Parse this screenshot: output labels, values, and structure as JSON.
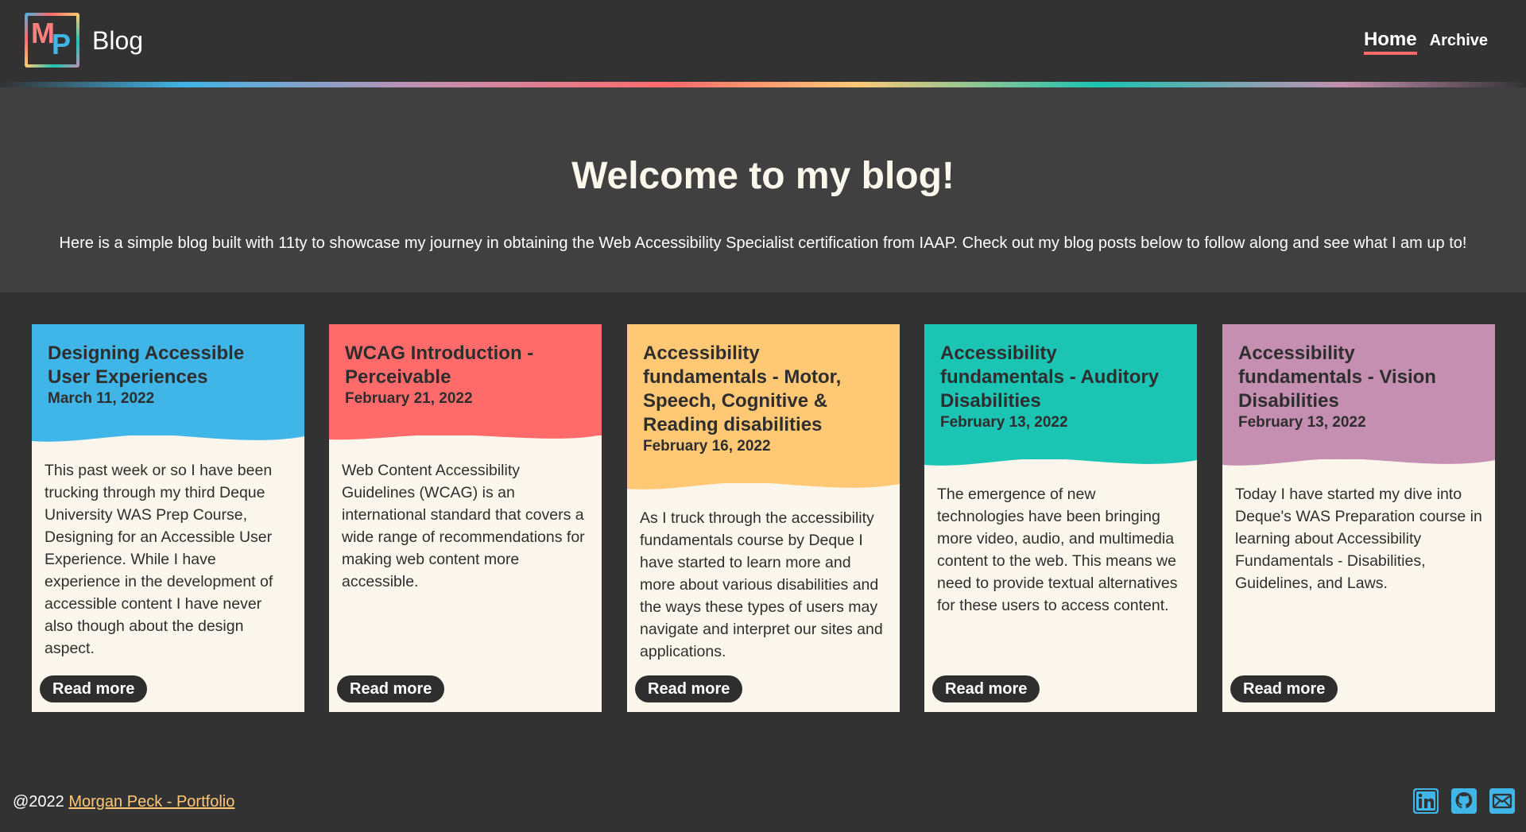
{
  "header": {
    "logo_letters": "MP",
    "site_title": "Blog",
    "nav": [
      {
        "label": "Home"
      },
      {
        "label": "Archive"
      }
    ]
  },
  "hero": {
    "title": "Welcome to my blog!",
    "intro": "Here is a simple blog built with 11ty to showcase my journey in obtaining the Web Accessibility Specialist certification from IAAP. Check out my blog posts below to follow along and see what I am up to!"
  },
  "posts": [
    {
      "title": "Designing Accessible User Experiences",
      "date": "March 11, 2022",
      "excerpt": "This past week or so I have been trucking through my third Deque University WAS Prep Course, Designing for an Accessible User Experience. While I have experience in the development of accessible content I have never also though about the design aspect.",
      "color": "#3fb5e8",
      "button": "Read more"
    },
    {
      "title": "WCAG Introduction - Perceivable",
      "date": "February 21, 2022",
      "excerpt": "Web Content Accessibility Guidelines (WCAG) is an international standard that covers a wide range of recommendations for making web content more accessible.",
      "color": "#ff6b6b",
      "button": "Read more"
    },
    {
      "title": "Accessibility fundamentals - Motor, Speech, Cognitive & Reading disabilities",
      "date": "February 16, 2022",
      "excerpt": "As I truck through the accessibility fundamentals course by Deque I have started to learn more and more about various disabilities and the ways these types of users may navigate and interpret our sites and applications.",
      "color": "#ffc875",
      "button": "Read more"
    },
    {
      "title": "Accessibility fundamentals - Auditory Disabilities",
      "date": "February 13, 2022",
      "excerpt": "The emergence of new technologies have been bringing more video, audio, and multimedia content to the web. This means we need to provide textual alternatives for these users to access content.",
      "color": "#1bc4b3",
      "button": "Read more"
    },
    {
      "title": "Accessibility fundamentals - Vision Disabilities",
      "date": "February 13, 2022",
      "excerpt": "Today I have started my dive into Deque's WAS Preparation course in learning about Accessibility Fundamentals - Disabilities, Guidelines, and Laws.",
      "color": "#c48fb0",
      "button": "Read more"
    }
  ],
  "footer": {
    "copyright": "@2022",
    "link_text": "Morgan Peck - Portfolio",
    "socials": [
      {
        "icon": "linkedin-icon",
        "label": "in"
      },
      {
        "icon": "github-icon"
      },
      {
        "icon": "email-icon"
      }
    ],
    "social_color": "#3fb5e8"
  }
}
